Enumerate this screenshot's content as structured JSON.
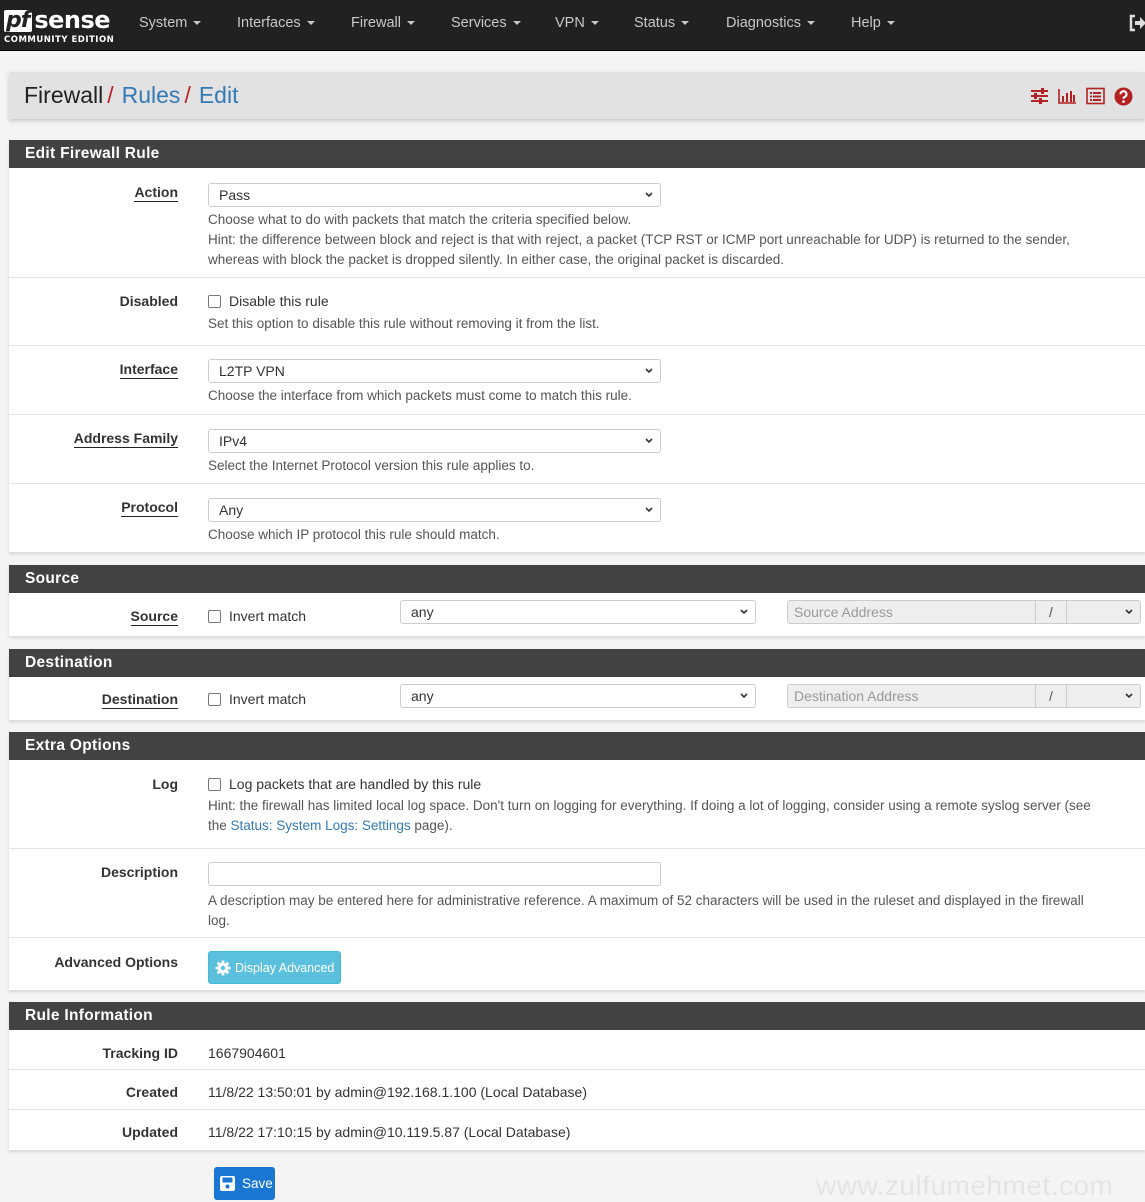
{
  "brand": {
    "logo_pf": "pf",
    "logo_sense": "sense",
    "edition": "COMMUNITY EDITION"
  },
  "nav": {
    "items": [
      {
        "label": "System"
      },
      {
        "label": "Interfaces"
      },
      {
        "label": "Firewall"
      },
      {
        "label": "Services"
      },
      {
        "label": "VPN"
      },
      {
        "label": "Status"
      },
      {
        "label": "Diagnostics"
      },
      {
        "label": "Help"
      }
    ],
    "logout_icon": "sign-out-icon"
  },
  "breadcrumb": {
    "items": [
      "Firewall",
      "Rules",
      "Edit"
    ],
    "separator": "/",
    "icons": [
      "sliders-icon",
      "bar-chart-icon",
      "list-alt-icon",
      "question-circle-icon"
    ]
  },
  "colors": {
    "accent_red": "#b22222",
    "link_blue": "#337ab7",
    "heading_bg": "#424242",
    "nav_bg": "#212121",
    "info_button": "#5bc0de",
    "save_button": "#1976d2"
  },
  "edit_rule": {
    "heading": "Edit Firewall Rule",
    "action": {
      "label": "Action",
      "value": "Pass",
      "help1": "Choose what to do with packets that match the criteria specified below.",
      "help2": "Hint: the difference between block and reject is that with reject, a packet (TCP RST or ICMP port unreachable for UDP) is returned to the sender,",
      "help3": "whereas with block the packet is dropped silently. In either case, the original packet is discarded."
    },
    "disabled": {
      "label": "Disabled",
      "checkbox_label": "Disable this rule",
      "checked": false,
      "help": "Set this option to disable this rule without removing it from the list."
    },
    "interface": {
      "label": "Interface",
      "value": "L2TP VPN",
      "help": "Choose the interface from which packets must come to match this rule."
    },
    "address_family": {
      "label": "Address Family",
      "value": "IPv4",
      "help": "Select the Internet Protocol version this rule applies to."
    },
    "protocol": {
      "label": "Protocol",
      "value": "Any",
      "help": "Choose which IP protocol this rule should match."
    }
  },
  "source": {
    "heading": "Source",
    "label": "Source",
    "invert_label": "Invert match",
    "invert_checked": false,
    "type_value": "any",
    "address_placeholder": "Source Address",
    "slash": "/",
    "mask_value": ""
  },
  "destination": {
    "heading": "Destination",
    "label": "Destination",
    "invert_label": "Invert match",
    "invert_checked": false,
    "type_value": "any",
    "address_placeholder": "Destination Address",
    "slash": "/",
    "mask_value": ""
  },
  "extra": {
    "heading": "Extra Options",
    "log": {
      "label": "Log",
      "checkbox_label": "Log packets that are handled by this rule",
      "checked": false,
      "help1": "Hint: the firewall has limited local log space. Don't turn on logging for everything. If doing a lot of logging, consider using a remote syslog server (see",
      "help2_pre": "the ",
      "help2_link": "Status: System Logs: Settings",
      "help2_post": " page)."
    },
    "description": {
      "label": "Description",
      "value": "",
      "help1": "A description may be entered here for administrative reference. A maximum of 52 characters will be used in the ruleset and displayed in the firewall",
      "help2": "log."
    },
    "advanced": {
      "label": "Advanced Options",
      "button": "Display Advanced"
    }
  },
  "rule_info": {
    "heading": "Rule Information",
    "tracking_label": "Tracking ID",
    "tracking_value": "1667904601",
    "created_label": "Created",
    "created_value": "11/8/22 13:50:01 by admin@192.168.1.100 (Local Database)",
    "updated_label": "Updated",
    "updated_value": "11/8/22 17:10:15 by admin@10.119.5.87 (Local Database)"
  },
  "save_button": "Save",
  "watermark": "www.zulfumehmet.com"
}
